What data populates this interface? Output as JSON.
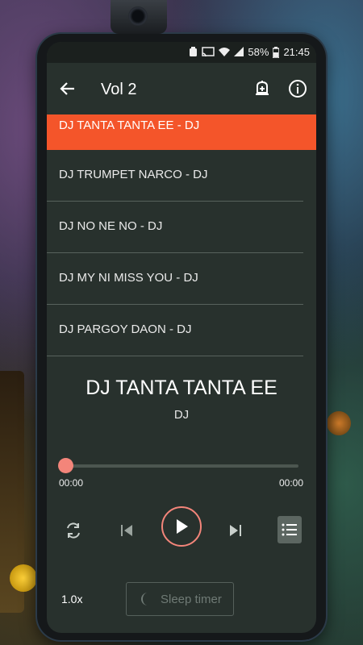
{
  "status": {
    "battery": "58%",
    "time": "21:45"
  },
  "toolbar": {
    "title": "Vol 2",
    "back_icon": "arrow-left-icon",
    "add_icon": "add-bell-icon",
    "info_icon": "info-icon"
  },
  "playlist": {
    "items": [
      {
        "label": "DJ TANTA TANTA EE - DJ",
        "active": true
      },
      {
        "label": "DJ TRUMPET NARCO - DJ"
      },
      {
        "label": "DJ NO NE NO - DJ"
      },
      {
        "label": "DJ MY NI MISS YOU - DJ"
      },
      {
        "label": "DJ PARGOY DAON - DJ"
      }
    ]
  },
  "now_playing": {
    "title": "DJ TANTA TANTA EE",
    "artist": "DJ",
    "elapsed": "00:00",
    "duration": "00:00",
    "progress": 0
  },
  "controls": {
    "speed": "1.0x",
    "sleep_timer": "Sleep timer"
  },
  "colors": {
    "accent": "#f4552a",
    "seek_thumb": "#f3857a",
    "background": "#28312d"
  }
}
